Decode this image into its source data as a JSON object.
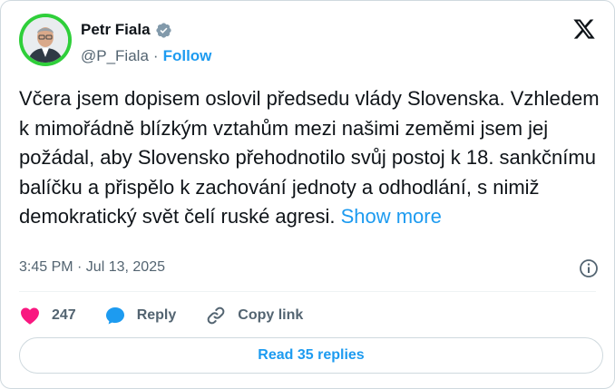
{
  "author": {
    "name": "Petr Fiala",
    "handle": "@P_Fiala",
    "separator": "·",
    "follow_label": "Follow",
    "verified": true,
    "avatar_ring_color": "#2fcf3a"
  },
  "tweet": {
    "text": "Včera jsem dopisem oslovil předsedu vlády Slovenska. Vzhledem k mimořádně blízkým vztahům mezi našimi zeměmi jsem jej požádal, aby Slovensko přehodnotilo svůj postoj k 18. sankčnímu balíčku a přispělo k zachování jednoty a odhodlání, s nimiž demokratický svět čelí ruské agresi. ",
    "show_more": "Show more",
    "timestamp": "3:45 PM · Jul 13, 2025"
  },
  "actions": {
    "likes_count": "247",
    "reply_label": "Reply",
    "copy_link_label": "Copy link"
  },
  "read_replies_label": "Read 35 replies",
  "colors": {
    "accent": "#1d9bf0",
    "like": "#f91880",
    "text": "#0f1419",
    "muted": "#536471"
  },
  "icons": {
    "verified": "verified-badge-icon",
    "x_logo": "x-logo-icon",
    "info": "info-icon",
    "like": "heart-icon",
    "reply": "speech-bubble-icon",
    "copy_link": "link-icon"
  }
}
